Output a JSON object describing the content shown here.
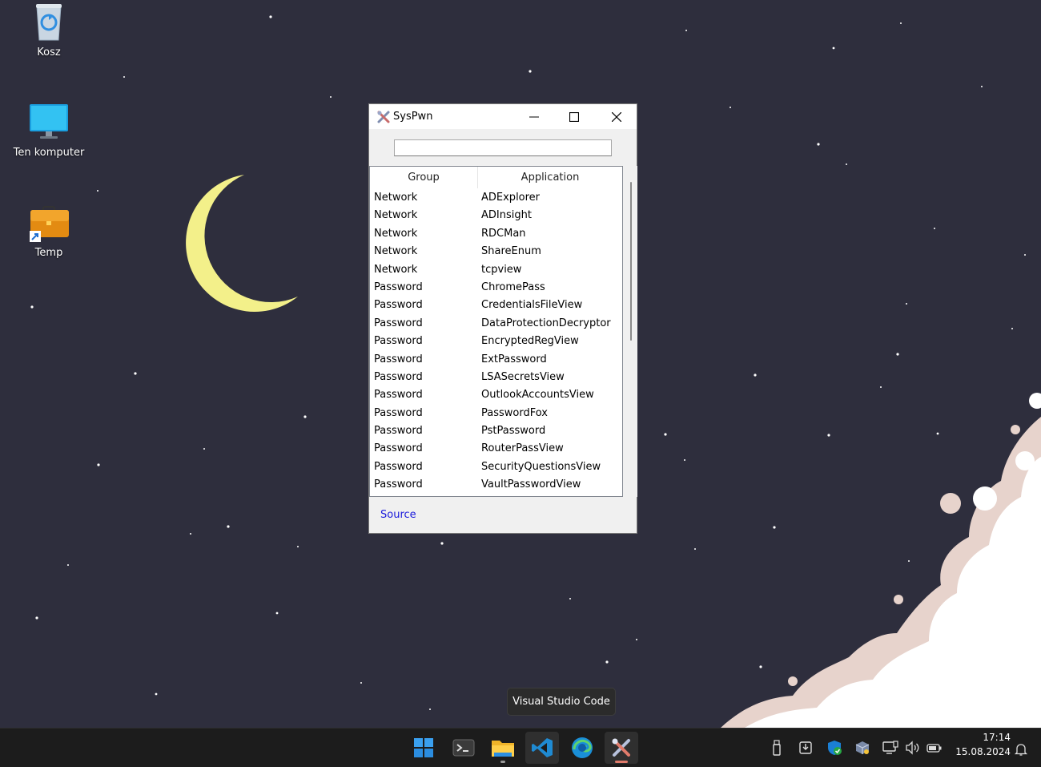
{
  "desktop": {
    "icons": [
      {
        "label": "Kosz",
        "icon": "recycle-bin-icon"
      },
      {
        "label": "Ten komputer",
        "icon": "monitor-icon"
      },
      {
        "label": "Temp",
        "icon": "folder-shortcut-icon"
      }
    ]
  },
  "window": {
    "title": "SysPwn",
    "search": {
      "value": "",
      "placeholder": ""
    },
    "columns": {
      "group": "Group",
      "application": "Application"
    },
    "rows": [
      {
        "group": "Network",
        "application": "ADExplorer"
      },
      {
        "group": "Network",
        "application": "ADInsight"
      },
      {
        "group": "Network",
        "application": "RDCMan"
      },
      {
        "group": "Network",
        "application": "ShareEnum"
      },
      {
        "group": "Network",
        "application": "tcpview"
      },
      {
        "group": "Password",
        "application": "ChromePass"
      },
      {
        "group": "Password",
        "application": "CredentialsFileView"
      },
      {
        "group": "Password",
        "application": "DataProtectionDecryptor"
      },
      {
        "group": "Password",
        "application": "EncryptedRegView"
      },
      {
        "group": "Password",
        "application": "ExtPassword"
      },
      {
        "group": "Password",
        "application": "LSASecretsView"
      },
      {
        "group": "Password",
        "application": "OutlookAccountsView"
      },
      {
        "group": "Password",
        "application": "PasswordFox"
      },
      {
        "group": "Password",
        "application": "PstPassword"
      },
      {
        "group": "Password",
        "application": "RouterPassView"
      },
      {
        "group": "Password",
        "application": "SecurityQuestionsView"
      },
      {
        "group": "Password",
        "application": "VaultPasswordView"
      }
    ],
    "source_link": "Source",
    "link_color": "#1a1adb"
  },
  "tooltip": {
    "text": "Visual Studio Code"
  },
  "taskbar": {
    "apps": [
      "start-icon",
      "terminal-icon",
      "file-explorer-icon",
      "vscode-icon",
      "edge-icon",
      "syspwn-icon"
    ],
    "tray": [
      "usb-icon",
      "download-icon",
      "defender-icon",
      "package-icon",
      "network-icon",
      "volume-icon",
      "battery-icon"
    ],
    "clock": {
      "time": "17:14",
      "date": "15.08.2024"
    }
  }
}
